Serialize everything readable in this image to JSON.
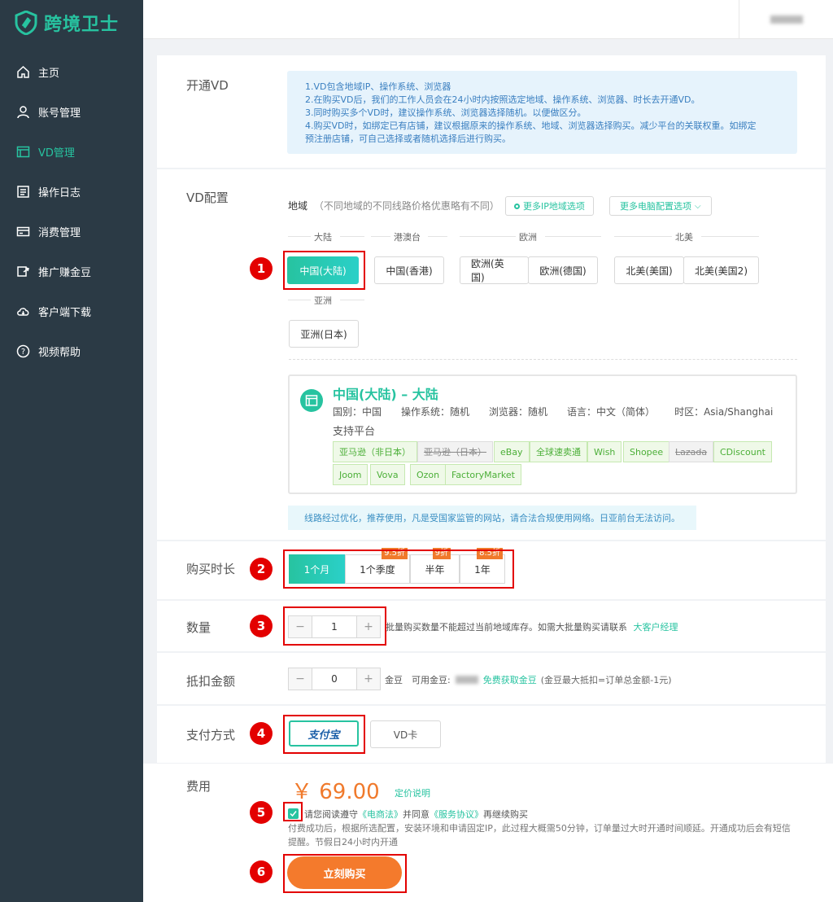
{
  "app": {
    "logo_text": "跨境卫士",
    "brand_color": "#27c3a0"
  },
  "sidebar": {
    "items": [
      {
        "label": "主页",
        "icon": "home-icon"
      },
      {
        "label": "账号管理",
        "icon": "user-icon"
      },
      {
        "label": "VD管理",
        "icon": "window-icon",
        "active": true
      },
      {
        "label": "操作日志",
        "icon": "log-icon"
      },
      {
        "label": "消费管理",
        "icon": "card-icon"
      },
      {
        "label": "推广赚金豆",
        "icon": "share-icon"
      },
      {
        "label": "客户端下载",
        "icon": "cloud-download-icon"
      },
      {
        "label": "视频帮助",
        "icon": "help-icon"
      }
    ]
  },
  "open_vd": {
    "label": "开通VD",
    "notes": [
      "1.VD包含地域IP、操作系统、浏览器",
      "2.在购买VD后，我们的工作人员会在24小时内按照选定地域、操作系统、浏览器、时长去开通VD。",
      "3.同时购买多个VD时，建议操作系统、浏览器选择随机。以便做区分。",
      "4.购买VD时，如绑定已有店铺，建议根据原来的操作系统、地域、浏览器选择购买。减少平台的关联权重。如绑定",
      "预注册店铺，可自己选择或者随机选择后进行购买。"
    ]
  },
  "vd_config": {
    "label": "VD配置",
    "region_label": "地域",
    "region_hint": "（不同地域的不同线路价格优惠略有不同）",
    "more_ip_btn": "更多IP地域选项",
    "more_pc_btn": "更多电脑配置选项",
    "groups": [
      {
        "name": "大陆"
      },
      {
        "name": "港澳台"
      },
      {
        "name": "欧洲"
      },
      {
        "name": "北美"
      },
      {
        "name": "亚洲"
      }
    ],
    "regions": [
      "中国(大陆)",
      "中国(香港)",
      "欧洲(英国)",
      "欧洲(德国)",
      "北美(美国)",
      "北美(美国2)",
      "亚洲(日本)"
    ],
    "selected": {
      "title": "中国(大陆) – 大陆",
      "details": [
        "国别：中国",
        "操作系统：随机",
        "浏览器：随机",
        "语言：中文（简体）",
        "时区：Asia/Shanghai"
      ],
      "platform_label": "支持平台",
      "platforms": [
        {
          "name": "亚马逊（非日本）",
          "disabled": false
        },
        {
          "name": "亚马逊（日本）",
          "disabled": true
        },
        {
          "name": "eBay",
          "disabled": false
        },
        {
          "name": "全球速卖通",
          "disabled": false
        },
        {
          "name": "Wish",
          "disabled": false
        },
        {
          "name": "Shopee",
          "disabled": false
        },
        {
          "name": "Lazada",
          "disabled": true
        },
        {
          "name": "CDiscount",
          "disabled": false
        },
        {
          "name": "Joom",
          "disabled": false
        },
        {
          "name": "Vova",
          "disabled": false
        },
        {
          "name": "Ozon",
          "disabled": false
        },
        {
          "name": "FactoryMarket",
          "disabled": false
        }
      ]
    },
    "route_note": "线路经过优化，推荐使用，凡是受国家监管的网站，请合法合规使用网络。日亚前台无法访问。"
  },
  "duration": {
    "label": "购买时长",
    "options": [
      {
        "label": "1个月",
        "discount": "",
        "selected": true
      },
      {
        "label": "1个季度",
        "discount": "9.5折"
      },
      {
        "label": "半年",
        "discount": "9折"
      },
      {
        "label": "1年",
        "discount": "8.5折"
      }
    ]
  },
  "quantity": {
    "label": "数量",
    "value": "1",
    "hint": "批量购买数量不能超过当前地域库存。如需大批量购买请联系",
    "link": "大客户经理"
  },
  "deduction": {
    "label": "抵扣金额",
    "value": "0",
    "unit": "金豆",
    "available_label": "可用金豆:",
    "get_link": "免费获取金豆",
    "rule": "(金豆最大抵扣=订单总金额-1元)"
  },
  "payment": {
    "label": "支付方式",
    "alipay": "支付宝",
    "vd_card": "VD卡"
  },
  "fee": {
    "label": "费用",
    "price": "￥ 69.00",
    "pricing_link": "定价说明",
    "agree_prefix": "请您阅读遵守",
    "law": "《电商法》",
    "agree_mid": "并同意",
    "terms": "《服务协议》",
    "agree_suffix": "再继续购买",
    "note": "付费成功后，根据所选配置，安装环境和申请固定IP，此过程大概需50分钟，订单量过大时开通时间顺延。开通成功后会有短信提醒。节假日24小时内开通",
    "buy_button": "立刻购买"
  },
  "markers": [
    "1",
    "2",
    "3",
    "4",
    "5",
    "6"
  ]
}
